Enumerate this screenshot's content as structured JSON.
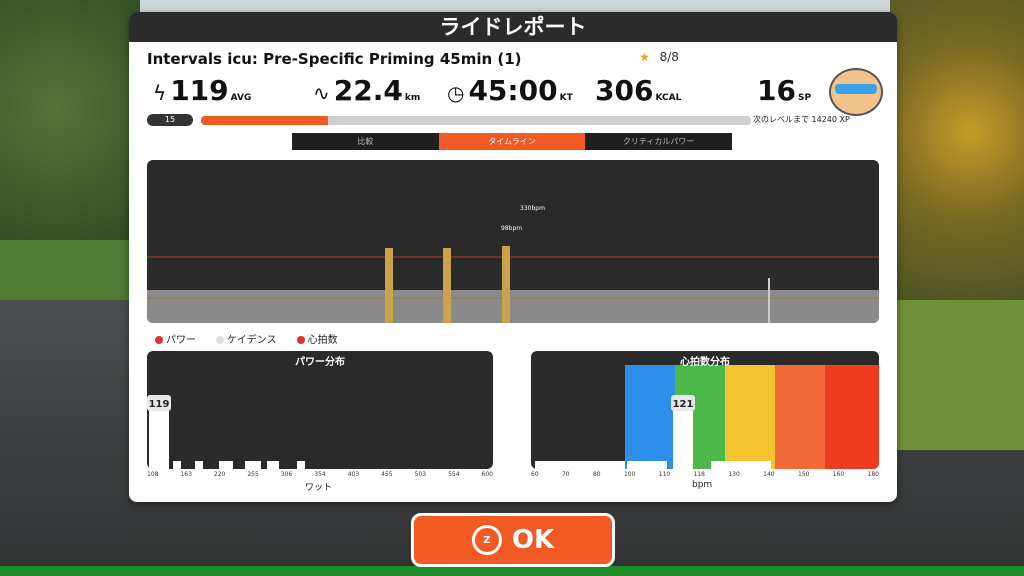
{
  "title": "ライドレポート",
  "workout_name": "Intervals icu: Pre-Specific Priming 45min (1)",
  "badge": {
    "icon": "star-icon",
    "text": "8/8"
  },
  "stats": [
    {
      "icon": "lightning-icon",
      "value": "119",
      "unit": "AVG"
    },
    {
      "icon": "route-icon",
      "value": "22.4",
      "unit": "km"
    },
    {
      "icon": "clock-icon",
      "value": "45:00",
      "unit": "KT"
    },
    {
      "icon": "",
      "value": "306",
      "unit": "KCAL"
    },
    {
      "icon": "",
      "value": "16",
      "unit": "SP"
    }
  ],
  "xp": {
    "level": "15",
    "progress_percent": 23,
    "text": "次のレベルまで 14240 XP"
  },
  "tabs": [
    {
      "label": "比較",
      "active": false
    },
    {
      "label": "タイムライン",
      "active": true
    },
    {
      "label": "クリティカルパワー",
      "active": false
    }
  ],
  "timeline": {
    "annotations": [
      "330bpm",
      "98bpm"
    ],
    "spikes": [
      0.33,
      0.41,
      0.49,
      0.85
    ]
  },
  "legend": [
    {
      "label": "パワー",
      "color": "#e03030"
    },
    {
      "label": "ケイデンス",
      "color": "#cccccc"
    },
    {
      "label": "心拍数",
      "color": "#e03030"
    }
  ],
  "power_hist": {
    "title": "パワー分布",
    "marker": "119",
    "xlabel": "ワット",
    "ticks": [
      "108",
      "163",
      "220",
      "255",
      "306",
      "354",
      "403",
      "455",
      "503",
      "554",
      "600"
    ]
  },
  "hr_hist": {
    "title": "心拍数分布",
    "marker": "121",
    "xlabel": "bpm",
    "ticks": [
      "60",
      "70",
      "80",
      "100",
      "110",
      "118",
      "130",
      "140",
      "150",
      "160",
      "180"
    ],
    "zones": [
      {
        "color": "#2d8fe8"
      },
      {
        "color": "#4db84a"
      },
      {
        "color": "#f4c430"
      },
      {
        "color": "#f26a3a"
      },
      {
        "color": "#ef3b1f"
      }
    ]
  },
  "ok_button": {
    "label": "OK",
    "logo": "zwift-logo"
  }
}
